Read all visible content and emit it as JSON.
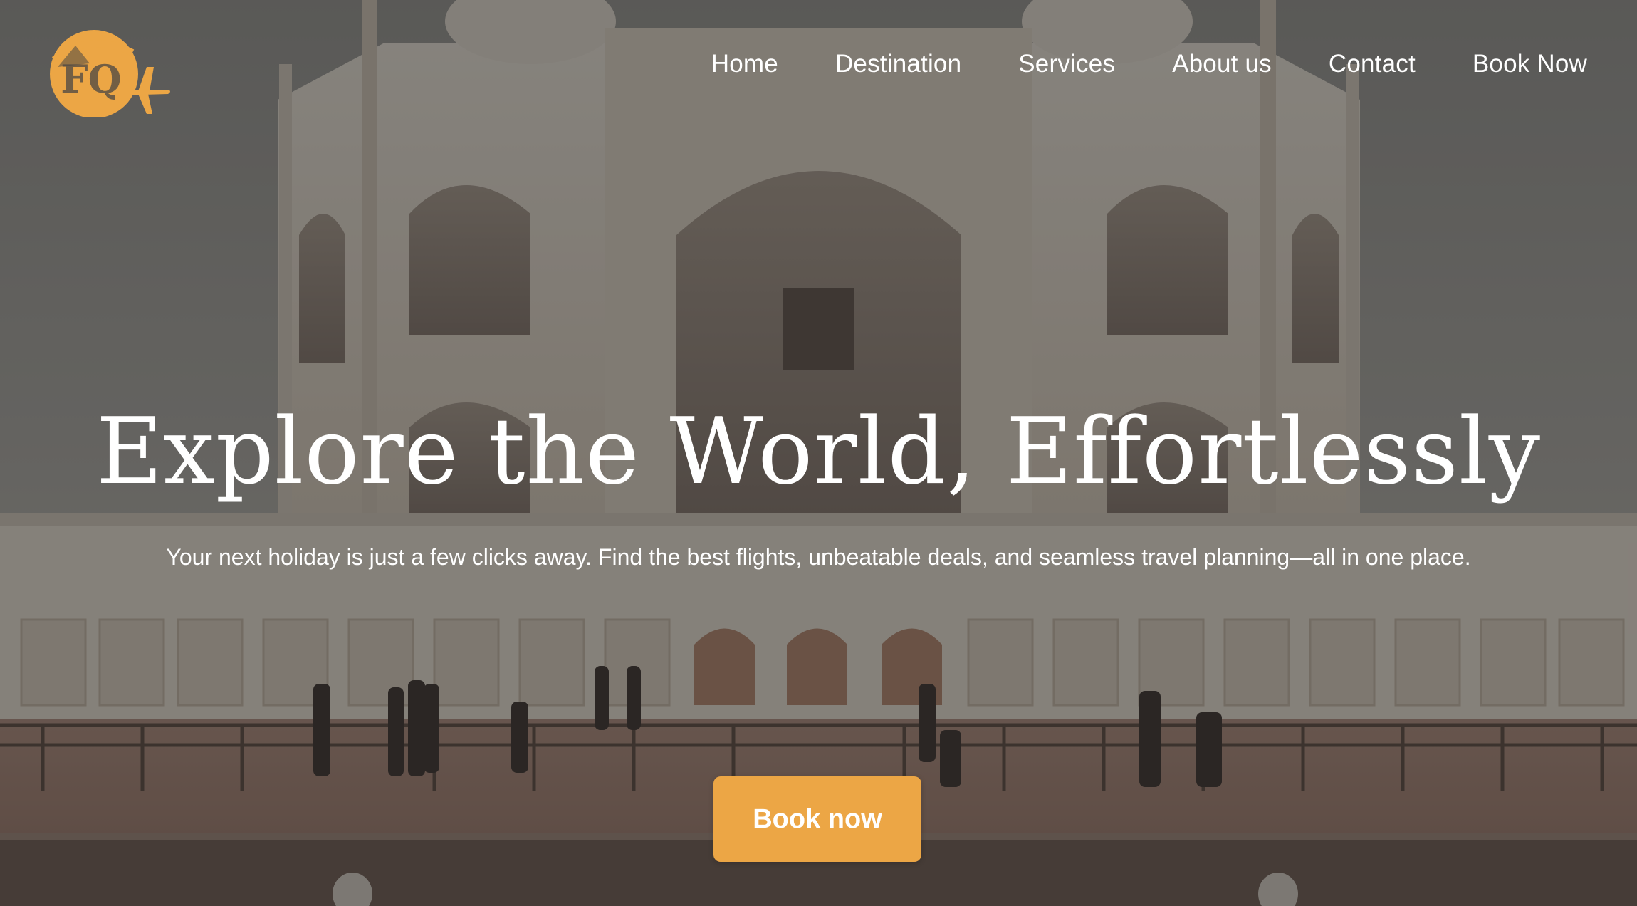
{
  "brand": {
    "logo_text": "FQ",
    "accent_color": "#eca645"
  },
  "nav": {
    "items": [
      {
        "label": "Home"
      },
      {
        "label": "Destination"
      },
      {
        "label": "Services"
      },
      {
        "label": "About us"
      },
      {
        "label": "Contact"
      },
      {
        "label": "Book Now"
      }
    ]
  },
  "hero": {
    "title": "Explore the World, Effortlessly",
    "subtitle": "Your next holiday is just a few clicks away. Find the best flights, unbeatable deals, and seamless travel planning—all in one place.",
    "cta_label": "Book now",
    "background_image": "taj-mahal-photo"
  },
  "colors": {
    "cta_background": "#eca645",
    "text": "#ffffff"
  }
}
